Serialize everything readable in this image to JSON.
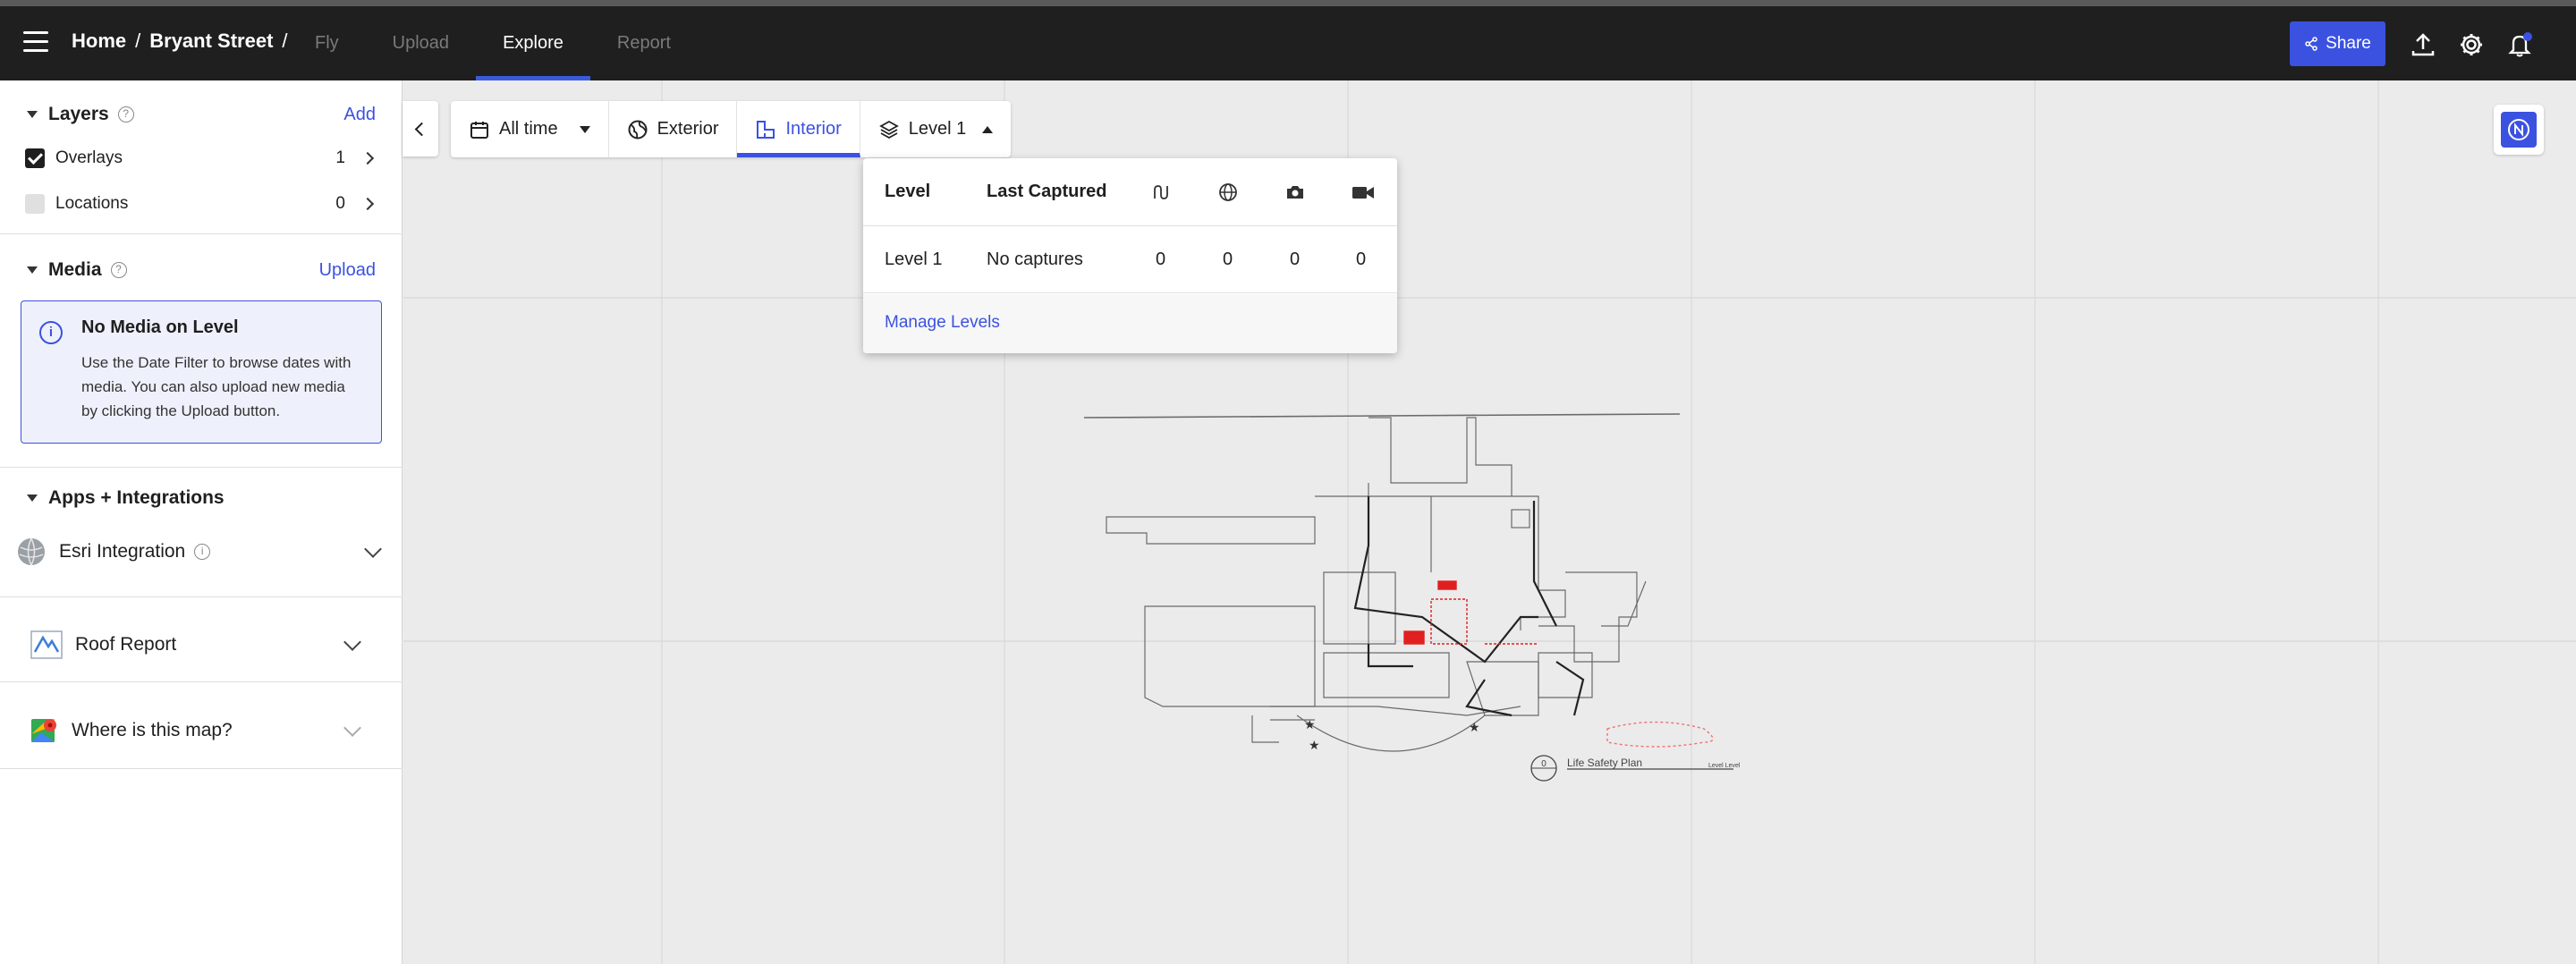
{
  "header": {
    "breadcrumb_home": "Home",
    "breadcrumb_sep": "/",
    "breadcrumb_project": "Bryant Street",
    "breadcrumb_sep2": "/",
    "tabs": [
      {
        "label": "Fly"
      },
      {
        "label": "Upload"
      },
      {
        "label": "Explore"
      },
      {
        "label": "Report"
      }
    ],
    "active_tab": "Explore",
    "share_label": "Share"
  },
  "sidebar": {
    "layers": {
      "title": "Layers",
      "action": "Add",
      "items": [
        {
          "label": "Overlays",
          "count": "1",
          "checked": true
        },
        {
          "label": "Locations",
          "count": "0",
          "checked": false
        }
      ]
    },
    "media": {
      "title": "Media",
      "action": "Upload",
      "info_title": "No Media on Level",
      "info_text": "Use the Date Filter to browse dates with media. You can also upload new media by clicking the Upload button."
    },
    "apps": {
      "title": "Apps + Integrations",
      "items": [
        {
          "label": "Esri Integration"
        },
        {
          "label": "Roof Report"
        },
        {
          "label": "Where is this map?"
        }
      ]
    }
  },
  "toolbar": {
    "date_filter": "All time",
    "exterior": "Exterior",
    "interior": "Interior",
    "level": "Level 1"
  },
  "level_panel": {
    "col_level": "Level",
    "col_last_captured": "Last Captured",
    "rows": [
      {
        "level": "Level 1",
        "last_captured": "No captures",
        "c1": "0",
        "c2": "0",
        "c3": "0",
        "c4": "0"
      }
    ],
    "manage_label": "Manage Levels"
  },
  "map": {
    "plan_title": "Life Safety Plan",
    "plan_number": "0",
    "plan_level": "Level Level"
  },
  "colors": {
    "accent": "#3b52e0",
    "topbar": "#1f1f1f",
    "map_bg": "#ebebeb",
    "highlight_red": "#e02020"
  }
}
